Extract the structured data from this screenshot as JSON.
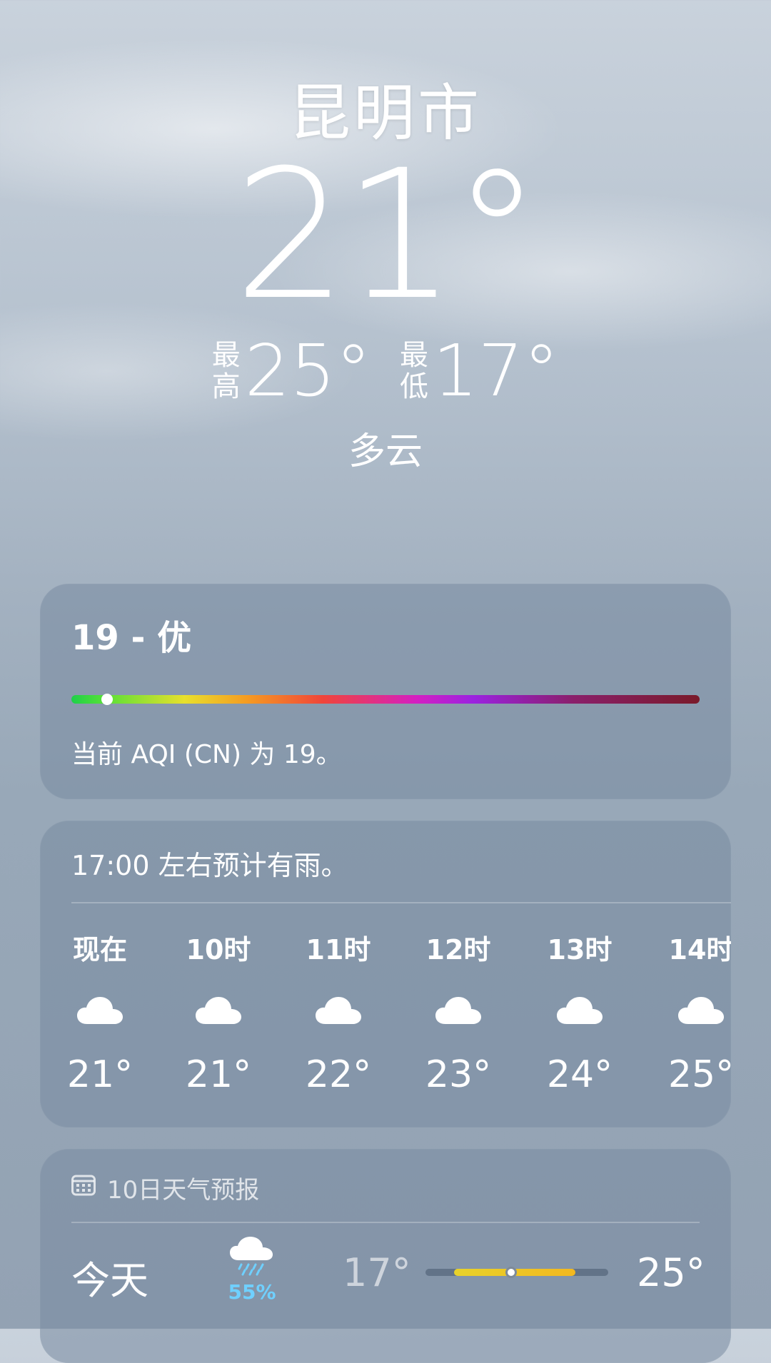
{
  "city": "昆明市",
  "current": {
    "temperature": "21°",
    "high_label_1": "最",
    "high_label_2": "高",
    "high": "25°",
    "low_label_1": "最",
    "low_label_2": "低",
    "low": "17°",
    "condition": "多云"
  },
  "aqi": {
    "title": "19 - 优",
    "value": 19,
    "scale_max": 500,
    "description": "当前 AQI (CN) 为 19。"
  },
  "hourly": {
    "summary": "17:00 左右预计有雨。",
    "items": [
      {
        "label": "现在",
        "icon": "cloud-icon",
        "temp": "21°"
      },
      {
        "label": "10时",
        "icon": "cloud-icon",
        "temp": "21°"
      },
      {
        "label": "11时",
        "icon": "cloud-icon",
        "temp": "22°"
      },
      {
        "label": "12时",
        "icon": "cloud-icon",
        "temp": "23°"
      },
      {
        "label": "13时",
        "icon": "cloud-icon",
        "temp": "24°"
      },
      {
        "label": "14时",
        "icon": "cloud-icon",
        "temp": "25°"
      }
    ]
  },
  "daily": {
    "header": "10日天气预报",
    "header_icon": "calendar-icon",
    "days": [
      {
        "name": "今天",
        "icon": "cloud-rain-icon",
        "precip": "55%",
        "low": "17°",
        "high": "25°",
        "current_temp": 21
      }
    ]
  },
  "colors": {
    "precip_blue": "#6fd0ff",
    "range_yellow": "#e8d22a",
    "card_bg": "rgba(120,138,160,0.55)"
  }
}
